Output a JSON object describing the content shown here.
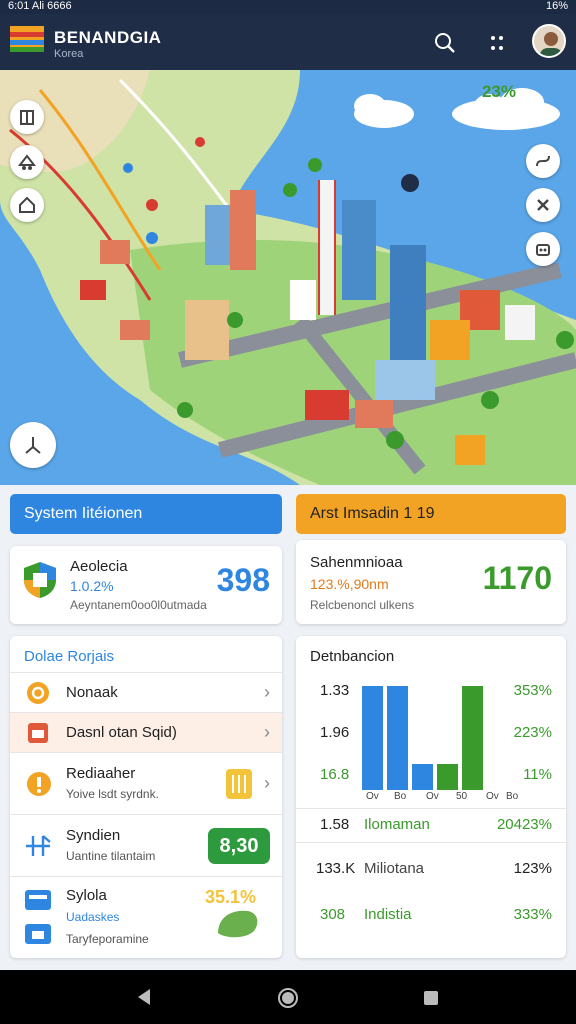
{
  "status": {
    "left": "6:01 Ali 6666",
    "right": "16%"
  },
  "app": {
    "title": "BENANDGIA",
    "subtitle": "Korea"
  },
  "map": {
    "weather_value": "23%"
  },
  "system_card": {
    "header": "System Iitéionen"
  },
  "stat_left": {
    "title": "Aeolecia",
    "value": "1.0.2%",
    "caption": "Aeyntanem0oo0l0utmada",
    "big_number": "398",
    "accent": "#2f86e0"
  },
  "analytics_card": {
    "header": "Arst Imsadin 1 19"
  },
  "stat_right": {
    "title": "Sahenmnioaa",
    "value": "123.%,90nm",
    "caption": "Relcbenoncl ulkens",
    "big_number": "1170",
    "accent": "#3a9a2c"
  },
  "list": {
    "title": "Dolae Rorjais",
    "items": [
      {
        "label": "Nonaak",
        "icon": "coin-icon",
        "color": "#f3a323"
      },
      {
        "label": "Dasnl otan Sqid)",
        "icon": "document-icon",
        "color": "#e05a3a"
      },
      {
        "label": "Rediaaher",
        "sub": "Yoive lsdt syrdnk.",
        "icon": "alert-icon",
        "color": "#f3a323"
      },
      {
        "label": "Syndien",
        "sub": "Uantine tilantaim",
        "icon": "network-icon",
        "color": "#2f86e0",
        "badge": "8,30"
      },
      {
        "label": "Sylola",
        "sub": "Uadaskes",
        "sub2": "Taryfeporamine",
        "icon": "card-icon",
        "color": "#2f86e0",
        "badge": "35.1%"
      }
    ]
  },
  "chart": {
    "title": "Detnbancion",
    "row_labels": [
      "1.33",
      "1.96",
      "16.8"
    ],
    "right_labels": [
      "353%",
      "223%",
      "11%"
    ],
    "x_labels": [
      "Ov",
      "Bo",
      "Ov",
      "50",
      "Ov",
      "Bo"
    ],
    "table": [
      {
        "left": "1.58",
        "name": "Ilomaman",
        "right": "20423%"
      },
      {
        "left": "133.K",
        "name": "Miliotana",
        "right": "123%"
      },
      {
        "left": "308",
        "name": "Indistia",
        "right": "333%"
      }
    ]
  },
  "chart_data": {
    "type": "bar",
    "categories": [
      "Ov",
      "Bo",
      "Ov",
      "50",
      "Ov",
      "Bo"
    ],
    "series": [
      {
        "values": [
          100,
          100,
          25,
          0,
          0,
          0
        ]
      },
      {
        "values": [
          0,
          0,
          0,
          25,
          100,
          0
        ]
      },
      {
        "values": [
          0,
          0,
          0,
          0,
          0,
          0
        ]
      }
    ]
  },
  "colors": {
    "blue": "#2f86e0",
    "green": "#3a9a2c",
    "orange": "#f3a323",
    "navy": "#1f2d47"
  }
}
